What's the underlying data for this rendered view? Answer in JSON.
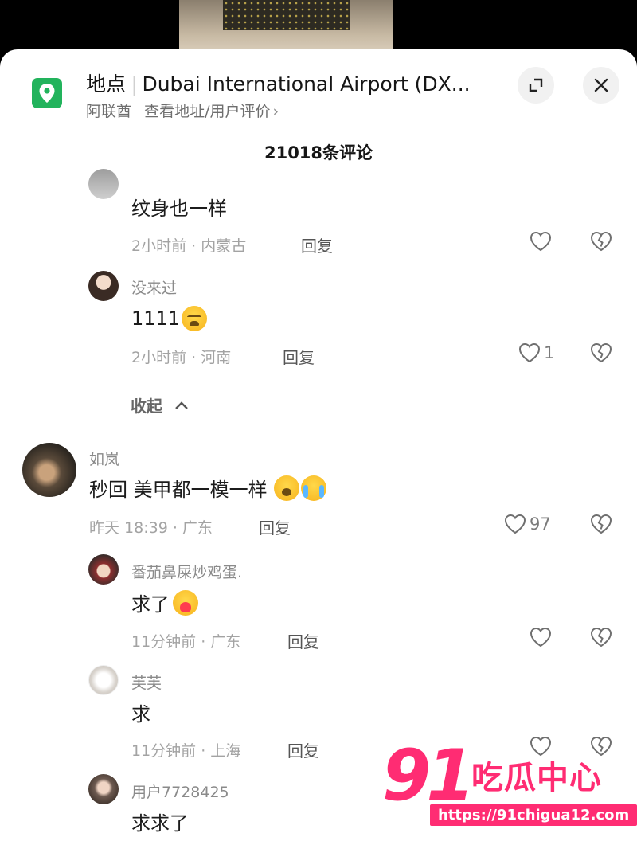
{
  "location": {
    "label": "地点",
    "name": "Dubai International Airport (DX...",
    "country": "阿联酋",
    "view_link": "查看地址/用户评价",
    "chevron": "›"
  },
  "icons": {
    "location": "map-pin-icon",
    "expand": "expand-icon",
    "close": "close-icon",
    "like": "heart-outline-icon",
    "dislike": "broken-heart-icon"
  },
  "comment_count": "21018条评论",
  "reply_label": "回复",
  "collapse_label": "收起",
  "collapse_caret": "^",
  "comments": [
    {
      "name": "",
      "text": "纹身也一样",
      "meta": "2小时前 · 内蒙古",
      "likes": ""
    },
    {
      "name": "没来过",
      "text": "1111",
      "meta": "2小时前 · 河南",
      "likes": "1"
    },
    {
      "name": "如岚",
      "text": "秒回 美甲都一模一样",
      "meta": "昨天 18:39 · 广东",
      "likes": "97"
    },
    {
      "name": "番茄鼻屎炒鸡蛋.",
      "text": "求了",
      "meta": "11分钟前 · 广东",
      "likes": ""
    },
    {
      "name": "芙芙",
      "text": "求",
      "meta": "11分钟前 · 上海",
      "likes": ""
    },
    {
      "name": "用户7728425",
      "text": "求求了",
      "meta": "",
      "likes": ""
    }
  ],
  "watermark": {
    "number": "91",
    "brand": "吃瓜中心",
    "url": "https://91chigua12.com"
  },
  "colors": {
    "accent_green": "#22b35c",
    "watermark_pink": "#ff2c73"
  }
}
